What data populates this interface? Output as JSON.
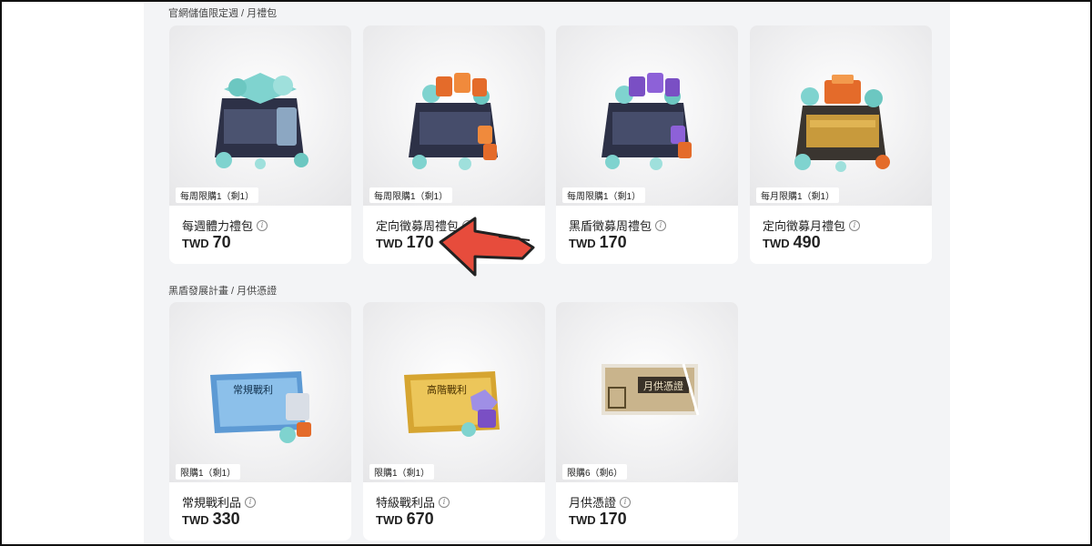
{
  "sections": [
    {
      "title": "官網儲值限定週 / 月禮包"
    },
    {
      "title": "黑盾發展計畫 / 月供憑證"
    }
  ],
  "products": [
    {
      "limit": "每周限購1（剩1）",
      "name": "每週體力禮包",
      "currency": "TWD",
      "price": "70"
    },
    {
      "limit": "每周限購1（剩1）",
      "name": "定向徵募周禮包",
      "currency": "TWD",
      "price": "170"
    },
    {
      "limit": "每周限購1（剩1）",
      "name": "黑盾徵募周禮包",
      "currency": "TWD",
      "price": "170"
    },
    {
      "limit": "每月限購1（剩1）",
      "name": "定向徵募月禮包",
      "currency": "TWD",
      "price": "490"
    },
    {
      "limit": "限購1（剩1）",
      "name": "常規戰利品",
      "currency": "TWD",
      "price": "330"
    },
    {
      "limit": "限購1（剩1）",
      "name": "特級戰利品",
      "currency": "TWD",
      "price": "670"
    },
    {
      "limit": "限購6（剩6）",
      "name": "月供憑證",
      "currency": "TWD",
      "price": "170"
    }
  ],
  "art_labels": {
    "ticket_blue": "常規戰利",
    "ticket_gold": "高階戰利",
    "voucher": "月供憑證"
  },
  "icons": {
    "info": "info-icon",
    "annotation": "red-arrow-icon"
  },
  "colors": {
    "arrow": "#e74c3c",
    "crate_dark": "#2d3147",
    "crystal": "#7fd3cf",
    "gold_ticket": "#d6a531",
    "blue_ticket": "#5d9ad4"
  }
}
